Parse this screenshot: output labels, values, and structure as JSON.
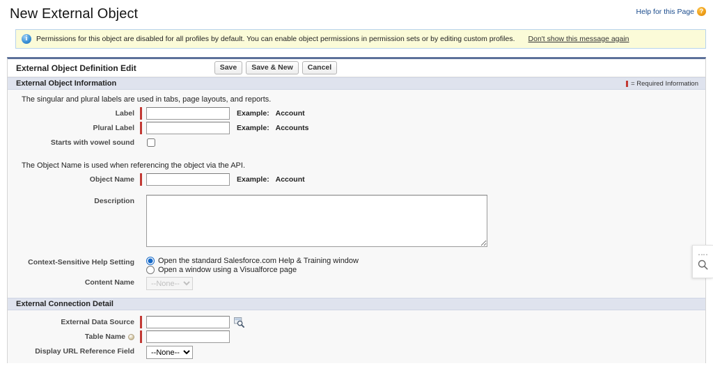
{
  "page": {
    "title": "New External Object",
    "help_link_label": "Help for this Page",
    "help_icon": "question-mark-icon"
  },
  "banner": {
    "icon": "info-icon",
    "message": "Permissions for this object are disabled for all profiles by default. You can enable object permissions in permission sets or by editing custom profiles.",
    "dismiss_label": "Don't show this message again"
  },
  "panel": {
    "title": "External Object Definition Edit",
    "buttons": [
      {
        "label": "Save",
        "name": "save-button"
      },
      {
        "label": "Save & New",
        "name": "save-and-new-button"
      },
      {
        "label": "Cancel",
        "name": "cancel-button"
      }
    ]
  },
  "sections": {
    "object_information": {
      "heading": "External Object Information",
      "required_legend": "= Required Information",
      "hint_labels": "The singular and plural labels are used in tabs, page layouts, and reports.",
      "hint_object_name": "The Object Name is used when referencing the object via the API.",
      "fields": {
        "label": {
          "label": "Label",
          "value": "",
          "placeholder": "",
          "example_prefix": "Example:",
          "example_value": "Account",
          "required": true
        },
        "plural_label": {
          "label": "Plural Label",
          "value": "",
          "placeholder": "",
          "example_prefix": "Example:",
          "example_value": "Accounts",
          "required": true
        },
        "vowel_sound": {
          "label": "Starts with vowel sound",
          "checked": false
        },
        "object_name": {
          "label": "Object Name",
          "value": "",
          "placeholder": "",
          "example_prefix": "Example:",
          "example_value": "Account",
          "required": true
        },
        "description": {
          "label": "Description",
          "value": "",
          "placeholder": ""
        },
        "help_setting": {
          "label": "Context-Sensitive Help Setting",
          "options": [
            {
              "label": "Open the standard Salesforce.com Help & Training window",
              "selected": true
            },
            {
              "label": "Open a window using a Visualforce page",
              "selected": false
            }
          ]
        },
        "content_name": {
          "label": "Content Name",
          "selected": "--None--",
          "options": [
            "--None--"
          ],
          "disabled": true
        }
      }
    },
    "connection_detail": {
      "heading": "External Connection Detail",
      "fields": {
        "external_data_source": {
          "label": "External Data Source",
          "value": "",
          "placeholder": "",
          "required": true,
          "lookup_icon": "lookup-magnifier-icon"
        },
        "table_name": {
          "label": "Table Name",
          "value": "",
          "placeholder": "",
          "required": true,
          "help_icon": "help-bubble-icon"
        },
        "display_url_reference_field": {
          "label": "Display URL Reference Field",
          "selected": "--None--",
          "options": [
            "--None--"
          ],
          "disabled": false
        }
      }
    }
  },
  "float_tab": {
    "drag_handle": "drag-handle-icon",
    "search_icon": "search-magnifier-icon"
  },
  "colors": {
    "required_marker": "#c23934",
    "section_header_bg": "#dfe3ee",
    "panel_top_border": "#5c7099",
    "banner_bg": "#fbfbd8",
    "banner_border": "#b7d3ec",
    "link": "#1a4b8c"
  }
}
